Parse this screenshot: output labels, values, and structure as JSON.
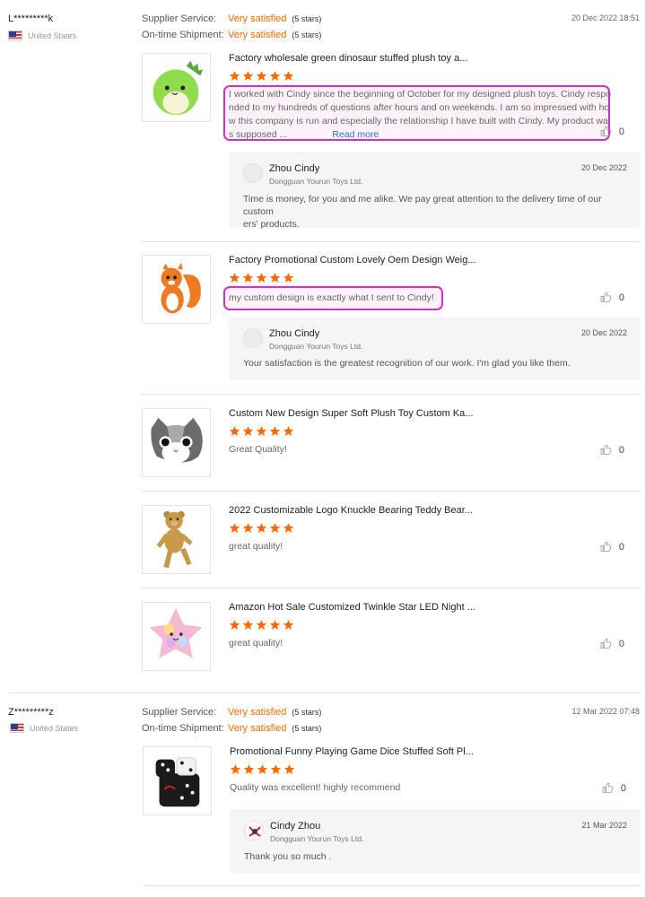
{
  "reviews": [
    {
      "reviewer": "L*********k",
      "country": "United States",
      "date": "20 Dec 2022 18:51",
      "ratings": [
        {
          "label": "Supplier Service:",
          "value": "Very satisfied",
          "stars": "(5 stars)"
        },
        {
          "label": "On-time Shipment:",
          "value": "Very satisfied",
          "stars": "(5 stars)"
        }
      ],
      "products": [
        {
          "title": "Factory wholesale green dinosaur stuffed plush toy a...",
          "image": "green-dinosaur-plush-image",
          "rating": 5,
          "comment_lines": [
            "I worked with Cindy since the beginning of October for my designed plush toys. Cindy respo",
            "nded to my hundreds of questions after hours and on weekends. I am so impressed with ho",
            "w this company is run and especially the relationship I have built with Cindy. My product wa",
            "s supposed ..."
          ],
          "read_more": "Read more",
          "likes": "0",
          "reply": {
            "name": "Zhou Cindy",
            "company": "Dongguan Yourun Toys Ltd.",
            "date": "20 Dec 2022",
            "text_lines": [
              "Time is money, for you and me alike. We pay great attention to the delivery time of our custom",
              "ers' products."
            ]
          }
        },
        {
          "title": "Factory Promotional Custom Lovely Oem Design Weig...",
          "image": "orange-squirrel-plush-image",
          "rating": 5,
          "comment_lines": [
            "my custom design is exactly what I sent to Cindy!"
          ],
          "likes": "0",
          "reply": {
            "name": "Zhou Cindy",
            "company": "Dongguan Yourun Toys Ltd.",
            "date": "20 Dec 2022",
            "text_lines": [
              "Your satisfaction is the greatest recognition of our work. I'm glad you like them."
            ]
          }
        },
        {
          "title": "Custom New Design Super Soft Plush Toy Custom Ka...",
          "image": "cat-face-pillow-image",
          "rating": 5,
          "comment_lines": [
            "Great Quality!"
          ],
          "likes": "0"
        },
        {
          "title": "2022 Customizable Logo Knuckle Bearing Teddy Bear...",
          "image": "teddy-bear-image",
          "rating": 5,
          "comment_lines": [
            "great quality!"
          ],
          "likes": "0"
        },
        {
          "title": "Amazon Hot Sale Customized Twinkle Star LED Night ...",
          "image": "led-star-pillow-image",
          "rating": 5,
          "comment_lines": [
            "great quality!"
          ],
          "likes": "0"
        }
      ]
    },
    {
      "reviewer": "Z*********z",
      "country": "United States",
      "date": "12 Mar 2022 07:48",
      "ratings": [
        {
          "label": "Supplier Service:",
          "value": "Very satisfied",
          "stars": "(5 stars)"
        },
        {
          "label": "On-time Shipment:",
          "value": "Very satisfied",
          "stars": "(5 stars)"
        }
      ],
      "products": [
        {
          "title": "Promotional Funny Playing Game Dice Stuffed Soft Pl...",
          "image": "plush-dice-image",
          "rating": 5,
          "comment_lines": [
            "Quality was excellent! highly recommend"
          ],
          "likes": "0",
          "reply": {
            "name": "Cindy Zhou",
            "company": "Dongguan Yourun Toys Ltd.",
            "date": "21 Mar 2022",
            "text_lines": [
              "Thank you so much ."
            ]
          }
        }
      ]
    }
  ],
  "colors": {
    "accent": "#ff6a00",
    "link": "#2a6fd4",
    "highlight_border": "#d430c8"
  }
}
